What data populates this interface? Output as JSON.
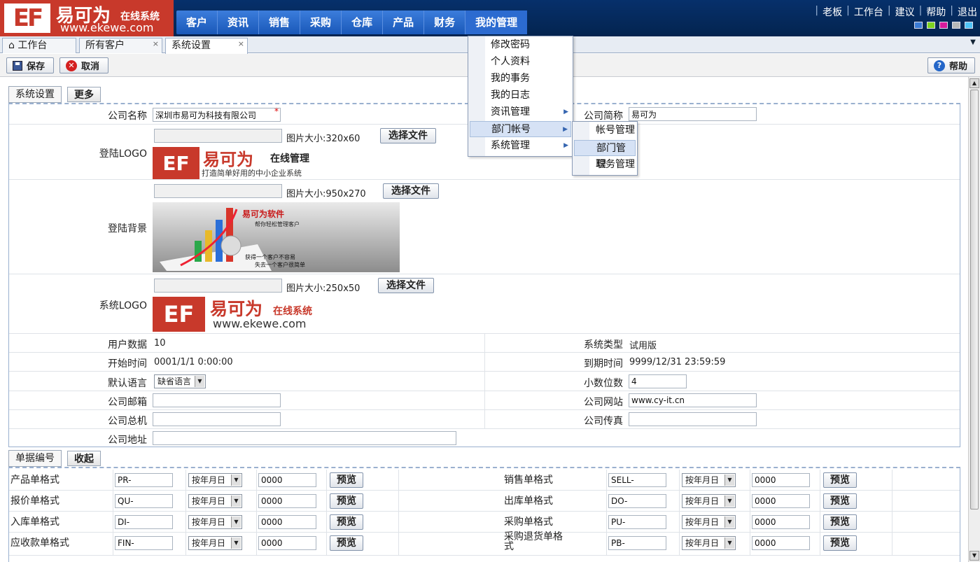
{
  "header": {
    "logo_mark": "EF",
    "brand": "易可为",
    "brand_sub": "在线系统",
    "url": "www.ekewe.com",
    "nav": [
      "客户",
      "资讯",
      "销售",
      "采购",
      "仓库",
      "产品",
      "财务",
      "我的管理"
    ],
    "top_links": [
      "老板",
      "工作台",
      "建议",
      "帮助",
      "退出"
    ],
    "swatch_colors": [
      "#3a7bd5",
      "#7ed321",
      "#d81b9d",
      "#b8b8b8",
      "#4fc3f7"
    ]
  },
  "tabs": [
    {
      "label": "工作台",
      "icon": "home-icon"
    },
    {
      "label": "所有客户",
      "close": "×"
    },
    {
      "label": "系统设置",
      "close": "×"
    }
  ],
  "toolbar": {
    "save": "保存",
    "cancel": "取消",
    "help": "帮助"
  },
  "section1": {
    "tab": "系统设置",
    "btn": "更多"
  },
  "form": {
    "company_name_label": "公司名称",
    "company_name": "深圳市易可为科技有限公司",
    "required": "*",
    "short_name_label": "公司简称",
    "short_name": "易可为",
    "login_logo_label": "登陆LOGO",
    "login_logo_size": "图片大小:320x60",
    "login_bg_label": "登陆背景",
    "login_bg_size": "图片大小:950x270",
    "sys_logo_label": "系统LOGO",
    "sys_logo_size": "图片大小:250x50",
    "choose_file": "选择文件",
    "login_logo_img": {
      "brand": "易可为",
      "tag": "在线管理",
      "slogan": "打造简单好用的中小企业系统"
    },
    "login_bg_img": {
      "title": "易可为软件",
      "sub": "帮你轻松管理客户",
      "l1": "获得一个客户不容易",
      "l2": "失去一个客户很简单"
    },
    "sys_logo_img": {
      "brand": "易可为",
      "tag": "在线系统",
      "url": "www.ekewe.com"
    },
    "user_count_label": "用户数据",
    "user_count": "10",
    "sys_type_label": "系统类型",
    "sys_type": "试用版",
    "start_label": "开始时间",
    "start": "0001/1/1 0:00:00",
    "expire_label": "到期时间",
    "expire": "9999/12/31 23:59:59",
    "lang_label": "默认语言",
    "lang": "缺省语言",
    "decimal_label": "小数位数",
    "decimal": "4",
    "email_label": "公司邮箱",
    "email": "",
    "website_label": "公司网站",
    "website": "www.cy-it.cn",
    "phone_label": "公司总机",
    "phone": "",
    "fax_label": "公司传真",
    "fax": "",
    "address_label": "公司地址",
    "address": ""
  },
  "section2": {
    "tab": "单据编号",
    "btn": "收起"
  },
  "doc_formats": {
    "preview": "预览",
    "date_mode": "按年月日",
    "left": [
      {
        "label": "产品单格式",
        "prefix": "PR-",
        "num": "0000"
      },
      {
        "label": "报价单格式",
        "prefix": "QU-",
        "num": "0000"
      },
      {
        "label": "入库单格式",
        "prefix": "DI-",
        "num": "0000"
      },
      {
        "label": "应收款单格式",
        "prefix": "FIN-",
        "num": "0000"
      }
    ],
    "right": [
      {
        "label": "销售单格式",
        "prefix": "SELL-",
        "num": "0000"
      },
      {
        "label": "出库单格式",
        "prefix": "DO-",
        "num": "0000"
      },
      {
        "label": "采购单格式",
        "prefix": "PU-",
        "num": "0000"
      },
      {
        "label": "采购退货单格式",
        "prefix": "PB-",
        "num": "0000"
      }
    ]
  },
  "menu": {
    "items": [
      "修改密码",
      "个人资料",
      "我的事务",
      "我的日志",
      "资讯管理",
      "部门帐号",
      "系统管理"
    ],
    "submenu": [
      "帐号管理",
      "部门管理",
      "职务管理"
    ]
  }
}
